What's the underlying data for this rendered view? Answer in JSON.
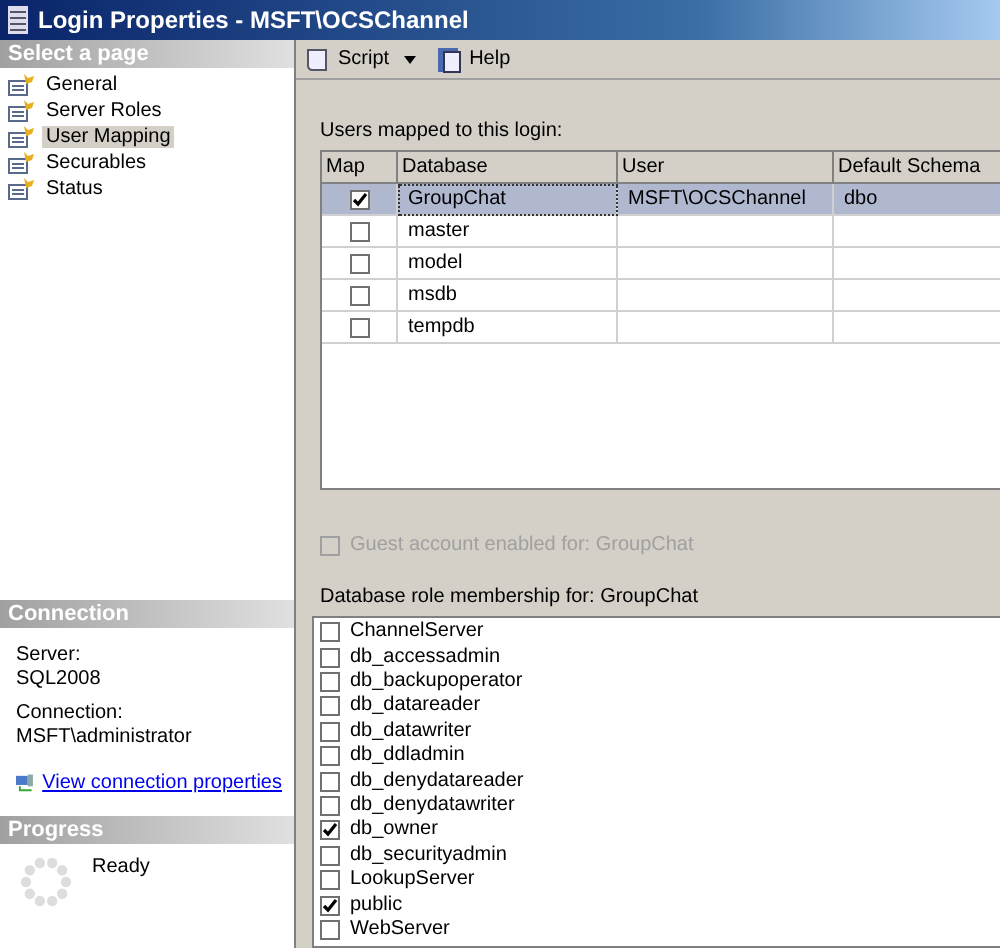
{
  "window": {
    "title": "Login Properties - MSFT\\OCSChannel"
  },
  "sidebar": {
    "header": "Select a page",
    "items": [
      {
        "label": "General",
        "selected": false
      },
      {
        "label": "Server Roles",
        "selected": false
      },
      {
        "label": "User Mapping",
        "selected": true
      },
      {
        "label": "Securables",
        "selected": false
      },
      {
        "label": "Status",
        "selected": false
      }
    ]
  },
  "connection": {
    "header": "Connection",
    "server_label": "Server:",
    "server": "SQL2008",
    "connection_label": "Connection:",
    "connection": "MSFT\\administrator",
    "link": "View connection properties"
  },
  "progress": {
    "header": "Progress",
    "status": "Ready"
  },
  "toolbar": {
    "script": "Script",
    "help": "Help"
  },
  "mapping": {
    "label": "Users mapped to this login:",
    "columns": [
      "Map",
      "Database",
      "User",
      "Default Schema"
    ],
    "rows": [
      {
        "checked": true,
        "selected": true,
        "database": "GroupChat",
        "user": "MSFT\\OCSChannel",
        "schema": "dbo"
      },
      {
        "checked": false,
        "selected": false,
        "database": "master",
        "user": "",
        "schema": ""
      },
      {
        "checked": false,
        "selected": false,
        "database": "model",
        "user": "",
        "schema": ""
      },
      {
        "checked": false,
        "selected": false,
        "database": "msdb",
        "user": "",
        "schema": ""
      },
      {
        "checked": false,
        "selected": false,
        "database": "tempdb",
        "user": "",
        "schema": ""
      }
    ]
  },
  "guest": {
    "label": "Guest account enabled for: GroupChat",
    "checked": false,
    "disabled": true
  },
  "roles": {
    "label": "Database role membership for: GroupChat",
    "items": [
      {
        "label": "ChannelServer",
        "checked": false
      },
      {
        "label": "db_accessadmin",
        "checked": false
      },
      {
        "label": "db_backupoperator",
        "checked": false
      },
      {
        "label": "db_datareader",
        "checked": false
      },
      {
        "label": "db_datawriter",
        "checked": false
      },
      {
        "label": "db_ddladmin",
        "checked": false
      },
      {
        "label": "db_denydatareader",
        "checked": false
      },
      {
        "label": "db_denydatawriter",
        "checked": false
      },
      {
        "label": "db_owner",
        "checked": true
      },
      {
        "label": "db_securityadmin",
        "checked": false
      },
      {
        "label": "LookupServer",
        "checked": false
      },
      {
        "label": "public",
        "checked": true
      },
      {
        "label": "WebServer",
        "checked": false
      }
    ]
  }
}
